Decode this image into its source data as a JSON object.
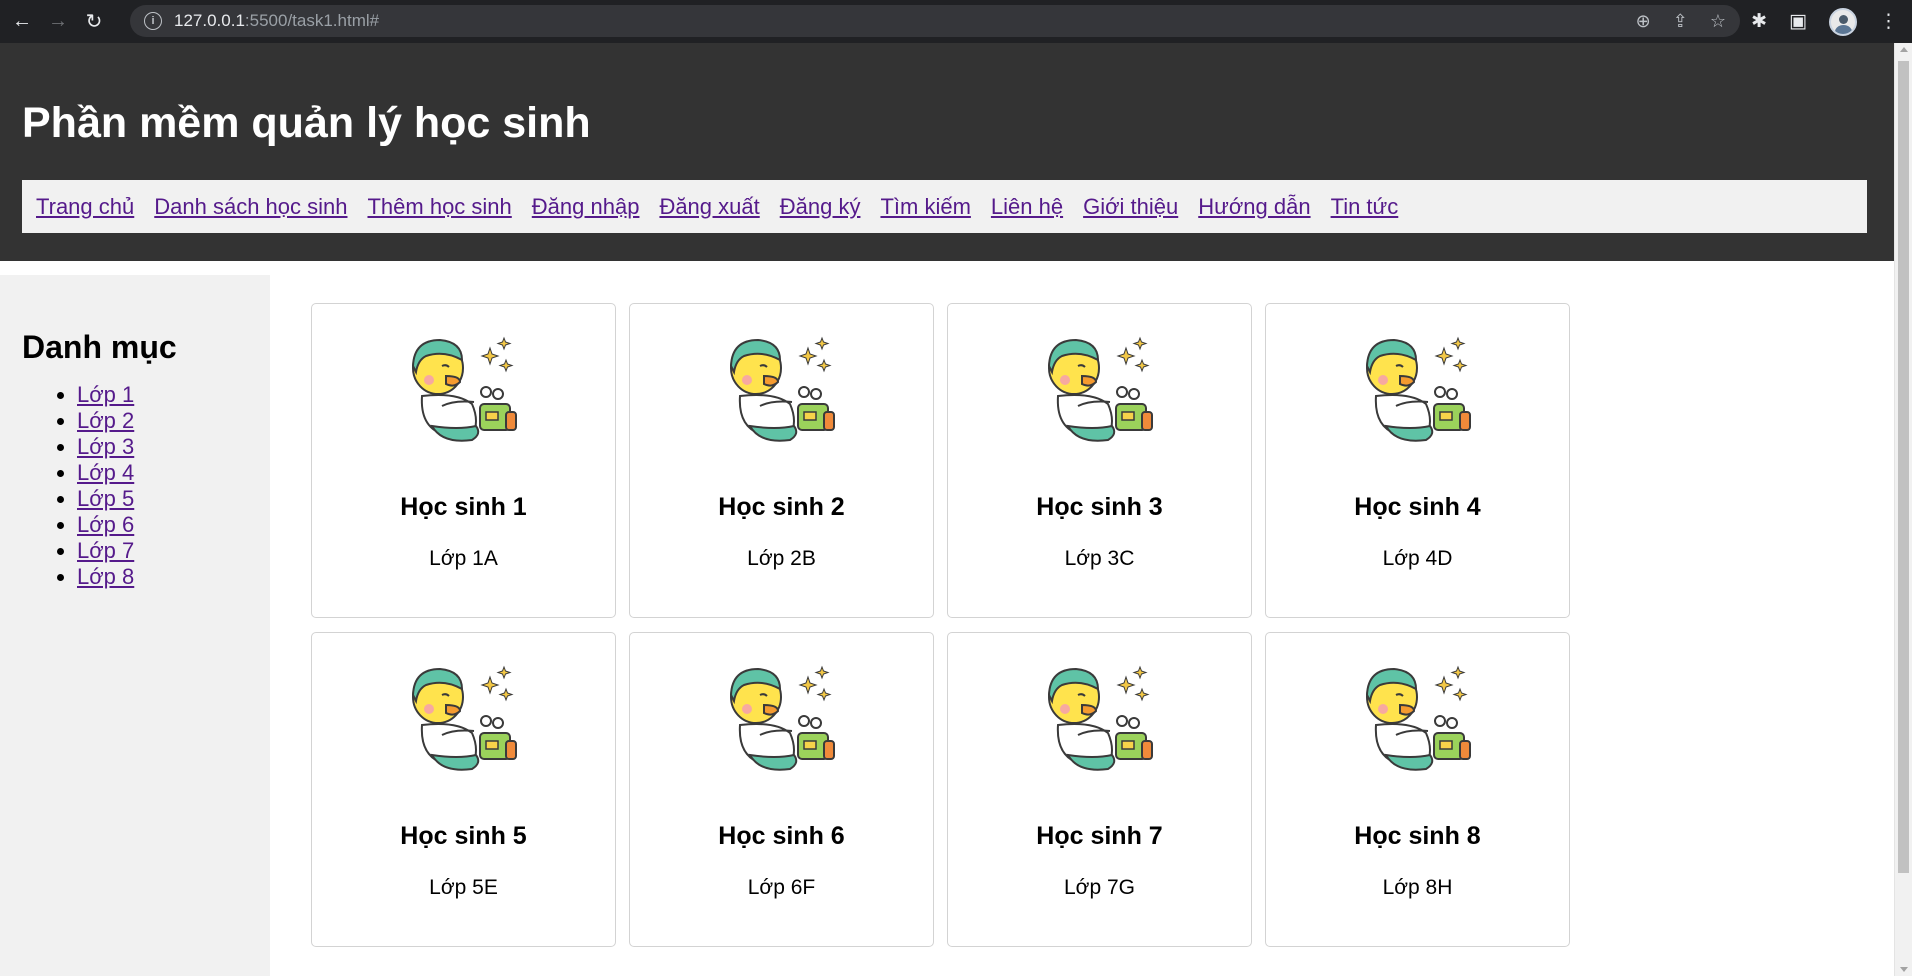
{
  "browser": {
    "url_host": "127.0.0.1",
    "url_rest": ":5500/task1.html#"
  },
  "header": {
    "title": "Phần mềm quản lý học sinh"
  },
  "topnav": [
    "Trang chủ",
    "Danh sách học sinh",
    "Thêm học sinh",
    "Đăng nhập",
    "Đăng xuất",
    "Đăng ký",
    "Tìm kiếm",
    "Liên hệ",
    "Giới thiệu",
    "Hướng dẫn",
    "Tin tức"
  ],
  "sidebar": {
    "title": "Danh mục",
    "items": [
      "Lớp 1",
      "Lớp 2",
      "Lớp 3",
      "Lớp 4",
      "Lớp 5",
      "Lớp 6",
      "Lớp 7",
      "Lớp 8"
    ]
  },
  "students": [
    {
      "name": "Học sinh 1",
      "class": "Lớp 1A"
    },
    {
      "name": "Học sinh 2",
      "class": "Lớp 2B"
    },
    {
      "name": "Học sinh 3",
      "class": "Lớp 3C"
    },
    {
      "name": "Học sinh 4",
      "class": "Lớp 4D"
    },
    {
      "name": "Học sinh 5",
      "class": "Lớp 5E"
    },
    {
      "name": "Học sinh 6",
      "class": "Lớp 6F"
    },
    {
      "name": "Học sinh 7",
      "class": "Lớp 7G"
    },
    {
      "name": "Học sinh 8",
      "class": "Lớp 8H"
    }
  ]
}
